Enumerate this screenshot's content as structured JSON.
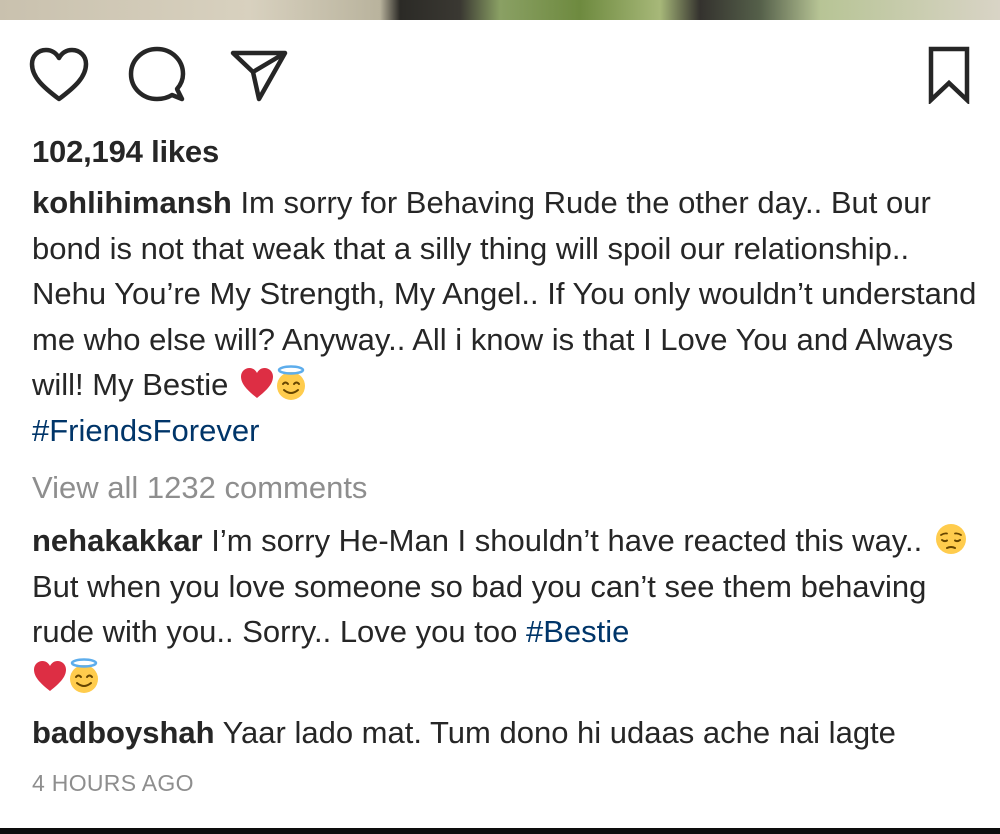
{
  "post": {
    "likes": "102,194 likes",
    "caption_user": "kohlihimansh",
    "caption_text": "Im sorry for Behaving Rude the other day.. But our bond is not that weak that a silly thing will spoil our relationship.. Nehu You’re My Strength, My Angel.. If You only wouldn’t understand me who else will? Anyway.. All i know is that I Love You and Always will! My Bestie",
    "caption_hashtag": "#FriendsForever",
    "view_all_comments": "View all 1232 comments",
    "timestamp": "4 HOURS AGO"
  },
  "comments": [
    {
      "user": "nehakakkar",
      "text_1": "I’m sorry He-Man I shouldn’t have reacted this way..",
      "text_2": "But when you love someone so bad you can’t see them behaving rude with you.. Sorry.. Love you too",
      "hashtag": "#Bestie"
    },
    {
      "user": "badboyshah",
      "text": "Yaar lado mat. Tum dono hi udaas ache nai lagte"
    }
  ],
  "icons": [
    "heart-icon",
    "comment-icon",
    "share-icon",
    "bookmark-icon",
    "red-heart-emoji",
    "halo-smile-emoji",
    "pensive-face-emoji"
  ],
  "colors": {
    "text": "#262626",
    "hashtag": "#003569",
    "muted": "#8e8e8e",
    "heart_red": "#dd2e44",
    "emoji_yellow": "#ffcc4d"
  }
}
